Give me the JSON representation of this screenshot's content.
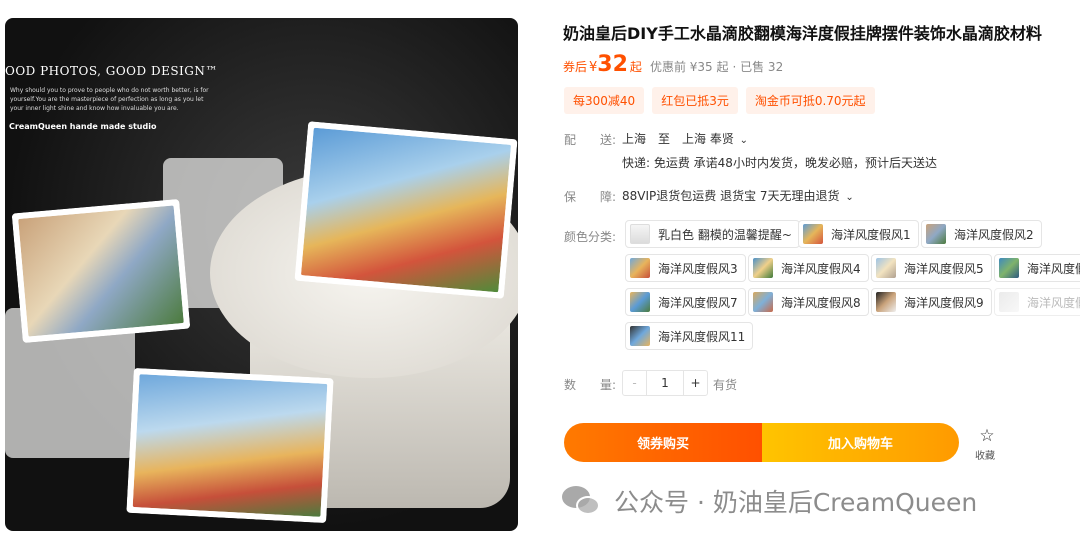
{
  "product": {
    "title": "奶油皇后DIY手工水晶滴胶翻模海洋度假挂牌摆件装饰水晶滴胶材料",
    "image": {
      "slogan": "OOD PHOTOS, GOOD DESIGN™",
      "small_text": "Why should you to prove to people who do not worth better, is for yourself.You are the masterpiece of perfection as long as you let your inner light shine and know how invaluable you are.",
      "studio": "CreamQueen hande made studio"
    }
  },
  "price": {
    "label": "券后",
    "symbol": "¥",
    "value": "32",
    "suffix": "起",
    "original": "优惠前 ¥35 起",
    "sold": "· 已售 32"
  },
  "coupons": [
    "每300减40",
    "红包已抵3元",
    "淘金币可抵0.70元起"
  ],
  "shipping": {
    "label": "配　　送:",
    "route": "上海　至　上海 奉贤",
    "detail": "快递: 免运费  承诺48小时内发货，晚发必赔，预计后天送达"
  },
  "guarantee": {
    "label": "保　　障:",
    "text": "88VIP退货包运费  退货宝  7天无理由退货"
  },
  "color": {
    "label": "颜色分类:",
    "options": [
      {
        "label": "乳白色  翻模的温馨提醒~",
        "disabled": false
      },
      {
        "label": "海洋风度假风1",
        "disabled": false
      },
      {
        "label": "海洋风度假风2",
        "disabled": false
      },
      {
        "label": "海洋风度假风3",
        "disabled": false
      },
      {
        "label": "海洋风度假风4",
        "disabled": false
      },
      {
        "label": "海洋风度假风5",
        "disabled": false
      },
      {
        "label": "海洋风度假",
        "disabled": false
      },
      {
        "label": "海洋风度假风7",
        "disabled": false
      },
      {
        "label": "海洋风度假风8",
        "disabled": false
      },
      {
        "label": "海洋风度假风9",
        "disabled": false
      },
      {
        "label": "海洋风度假",
        "disabled": true
      },
      {
        "label": "海洋风度假风11",
        "disabled": false
      }
    ]
  },
  "quantity": {
    "label": "数　　量:",
    "minus": "-",
    "value": "1",
    "plus": "+",
    "stock": "有货"
  },
  "actions": {
    "buy": "领券购买",
    "cart": "加入购物车",
    "favorite": "收藏"
  },
  "watermark": "公众号 · 奶油皇后CreamQueen",
  "icons": {
    "chevron": "chevron-down-icon",
    "favorite": "star-outline-icon",
    "watermark": "wechat-icon"
  },
  "colors": {
    "accent": "#ff5000",
    "coupon_bg": "#fff1ea",
    "buy_gradient": [
      "#ff7a00",
      "#ff5000"
    ],
    "cart_gradient": [
      "#ffc400",
      "#ff9a00"
    ]
  }
}
